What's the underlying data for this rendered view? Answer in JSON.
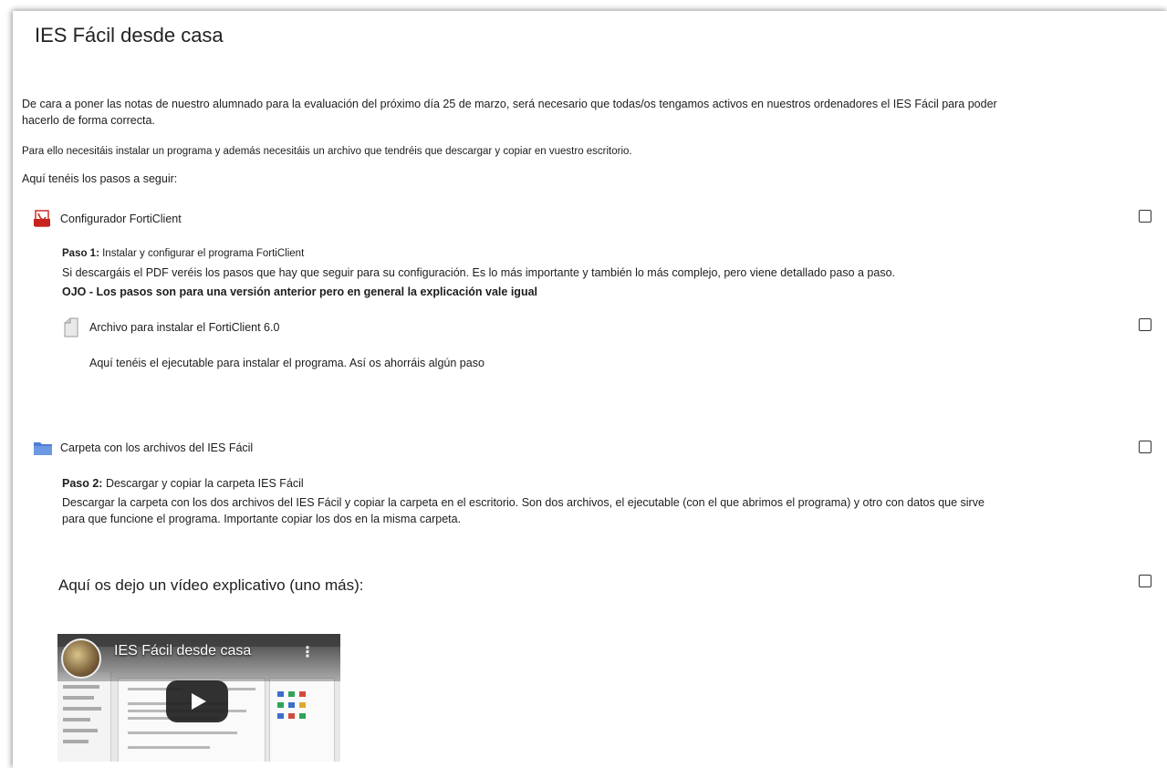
{
  "page": {
    "title": "IES Fácil desde casa"
  },
  "intro": {
    "line1": "De cara a poner las notas de nuestro alumnado para la evaluación del próximo día 25 de marzo, será necesario que todas/os tengamos activos en nuestros ordenadores el IES Fácil para poder",
    "line2": "hacerlo de forma correcta.",
    "line3": "Para ello necesitáis instalar un programa y además necesitáis un archivo que tendréis que descargar y copiar en vuestro escritorio.",
    "line4": "Aquí tenéis los pasos a seguir:"
  },
  "activities": {
    "forticlient_config": {
      "label": "Configurador FortiClient",
      "icon": "pdf-icon",
      "step_bold": "Paso 1:",
      "step_text": " Instalar y configurar el programa FortiClient",
      "desc": "Si descargáis el PDF veréis los pasos que hay que seguir para su configuración. Es lo más importante y también lo más complejo, pero viene detallado paso a paso.",
      "warning": "OJO - Los pasos son para una versión anterior pero en general la explicación vale igual"
    },
    "forticlient_installer": {
      "label": "Archivo para instalar el FortiClient 6.0",
      "icon": "file-icon",
      "desc": "Aquí tenéis el ejecutable para instalar el programa. Así os ahorráis algún paso"
    },
    "ies_folder": {
      "label": "Carpeta con los archivos del IES Fácil",
      "icon": "folder-icon",
      "step_bold": "Paso 2:",
      "step_text": " Descargar y copiar la carpeta IES Fácil",
      "desc_line1": "Descargar la carpeta con los dos archivos del IES Fácil y copiar la carpeta en el escritorio. Son dos archivos, el ejecutable (con el que abrimos el programa) y otro con datos que sirve",
      "desc_line2": "para que funcione el programa. Importante copiar los dos en la misma carpeta."
    },
    "video": {
      "heading": "Aquí os dejo un vídeo explicativo (uno más):",
      "video_title": "IES Fácil desde casa",
      "menu_glyph": "⋮"
    }
  },
  "colors": {
    "text": "#1d1d1d",
    "pdf_red": "#c8231d",
    "folder_blue": "#4f7fd4",
    "play_button": "#212121"
  }
}
